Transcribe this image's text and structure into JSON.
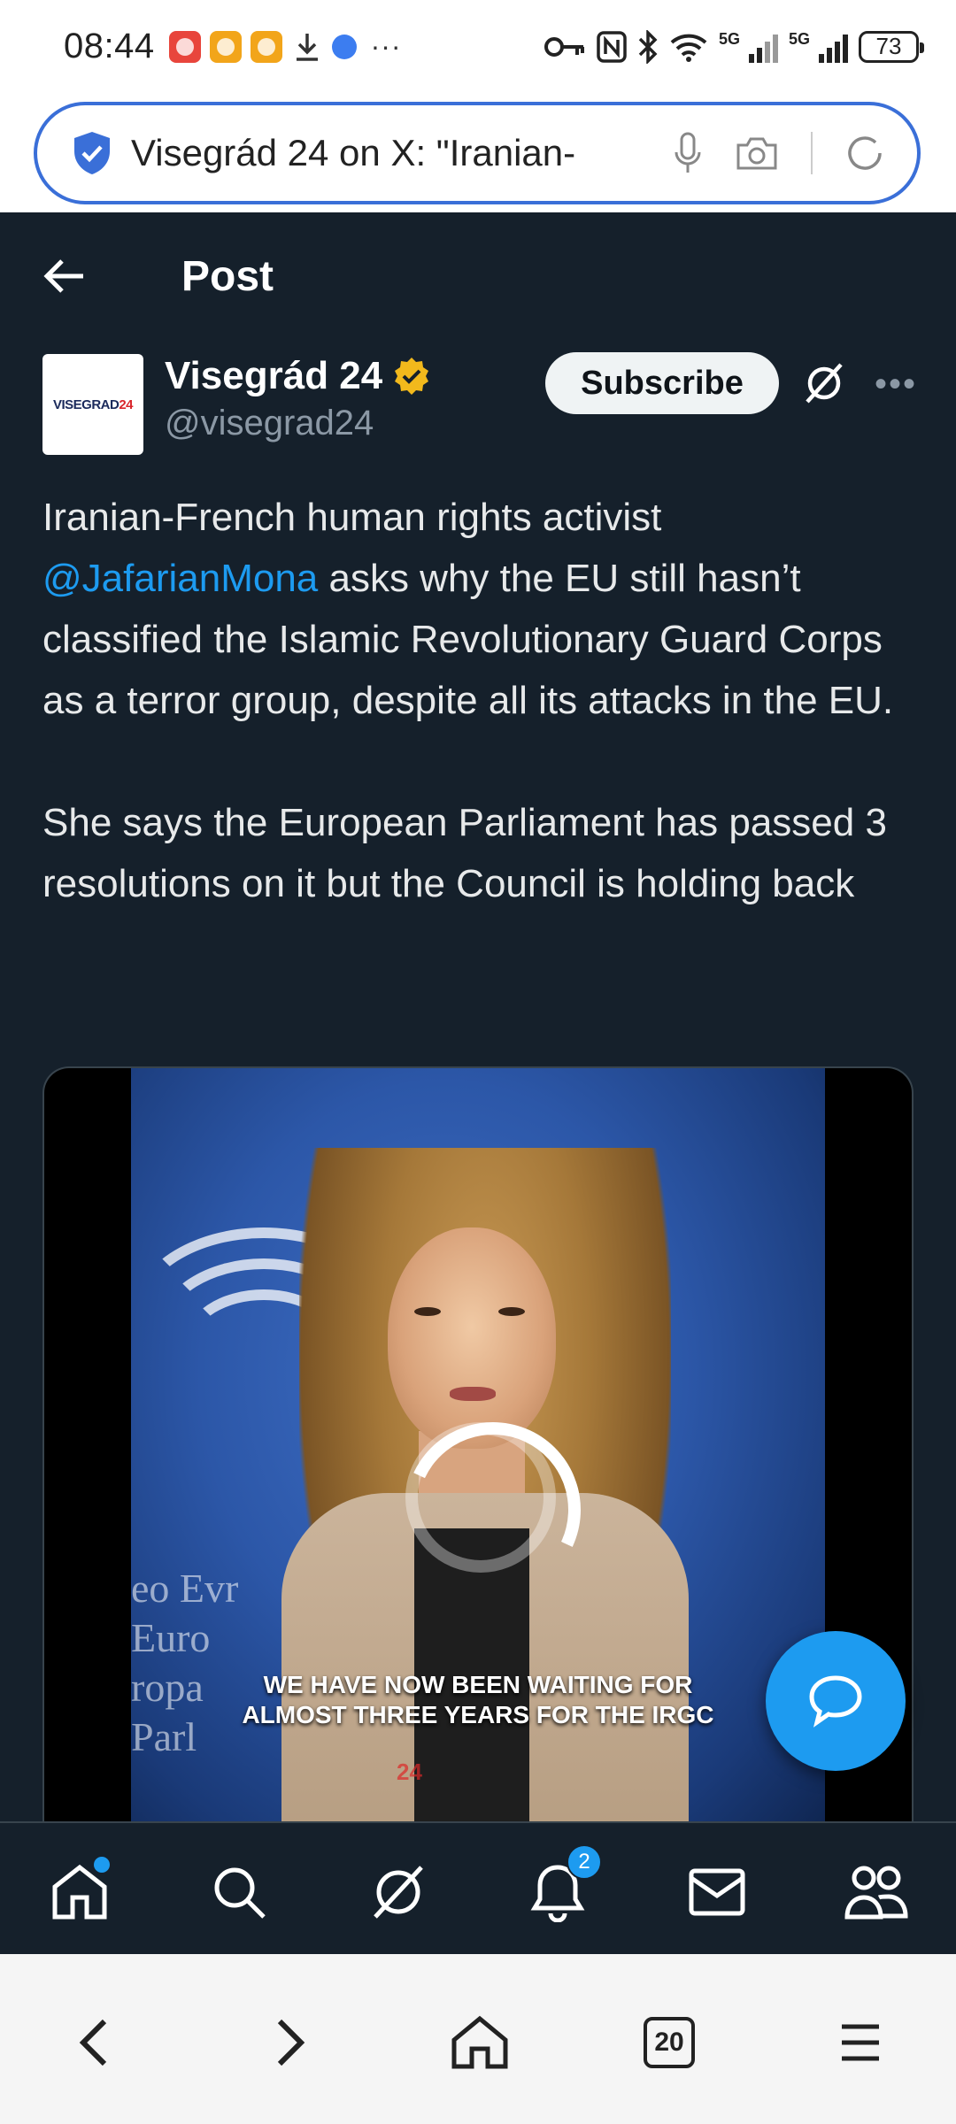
{
  "status_bar": {
    "time": "08:44",
    "battery": "73",
    "network": "5G"
  },
  "browser": {
    "url_text": "Visegrád 24 on X: \"Iranian-",
    "tab_count": "20"
  },
  "header": {
    "title": "Post"
  },
  "author": {
    "name": "Visegrád 24",
    "handle": "@visegrad24",
    "avatar_text_main": "VISEGRAD",
    "avatar_text_accent": "24",
    "subscribe_label": "Subscribe"
  },
  "tweet": {
    "line1_before": "Iranian-French human rights activist",
    "mention": "@JafarianMona",
    "line1_after": " asks why the EU still hasn’t classified the Islamic Revolutionary Guard Corps as a terror group, despite all its attacks in the EU.",
    "paragraph2": "She says the European Parliament has passed 3 resolutions on it but the Council is holding back"
  },
  "media": {
    "caption_line1": "WE HAVE NOW BEEN WAITING FOR",
    "caption_line2": "ALMOST THREE YEARS FOR THE IRGC",
    "background_text": "eo Evr\nEuro\nropa\nParl",
    "watermark": "24"
  },
  "tabbar": {
    "notifications_badge": "2"
  },
  "colors": {
    "background": "#15202b",
    "accent": "#1d9bf0",
    "verified": "#f2b91c"
  },
  "icons": [
    "key-icon",
    "nfc-icon",
    "bluetooth-icon",
    "wifi-icon",
    "signal-icon",
    "verified-shield-icon",
    "mic-icon",
    "camera-icon",
    "refresh-icon",
    "back-arrow-icon",
    "verified-badge-icon",
    "grok-icon",
    "more-icon",
    "compose-icon",
    "home-icon",
    "search-icon",
    "notifications-icon",
    "messages-icon",
    "communities-icon",
    "chevron-left-icon",
    "chevron-right-icon",
    "browser-home-icon",
    "tabs-icon",
    "menu-icon"
  ]
}
